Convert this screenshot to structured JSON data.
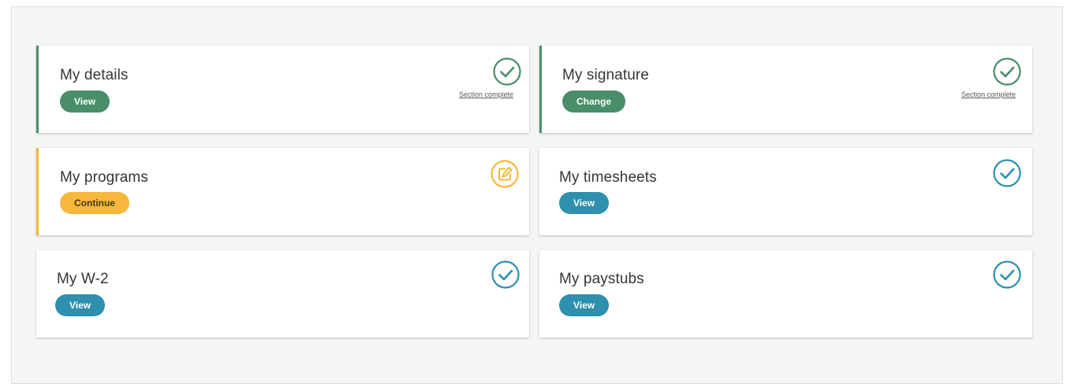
{
  "colors": {
    "complete_green": "#4a8d6a",
    "in_progress_orange": "#f6b73c",
    "info_blue": "#2e8fae"
  },
  "cards": {
    "details": {
      "title": "My details",
      "button_label": "View",
      "status_icon": "check-circle-icon",
      "status_text": "Section complete"
    },
    "signature": {
      "title": "My signature",
      "button_label": "Change",
      "status_icon": "check-circle-icon",
      "status_text": "Section complete"
    },
    "programs": {
      "title": "My programs",
      "button_label": "Continue",
      "status_icon": "edit-circle-icon"
    },
    "timesheets": {
      "title": "My timesheets",
      "button_label": "View",
      "status_icon": "check-circle-icon"
    },
    "w2": {
      "title": "My W-2",
      "button_label": "View",
      "status_icon": "check-circle-icon"
    },
    "paystubs": {
      "title": "My paystubs",
      "button_label": "View",
      "status_icon": "check-circle-icon"
    }
  }
}
